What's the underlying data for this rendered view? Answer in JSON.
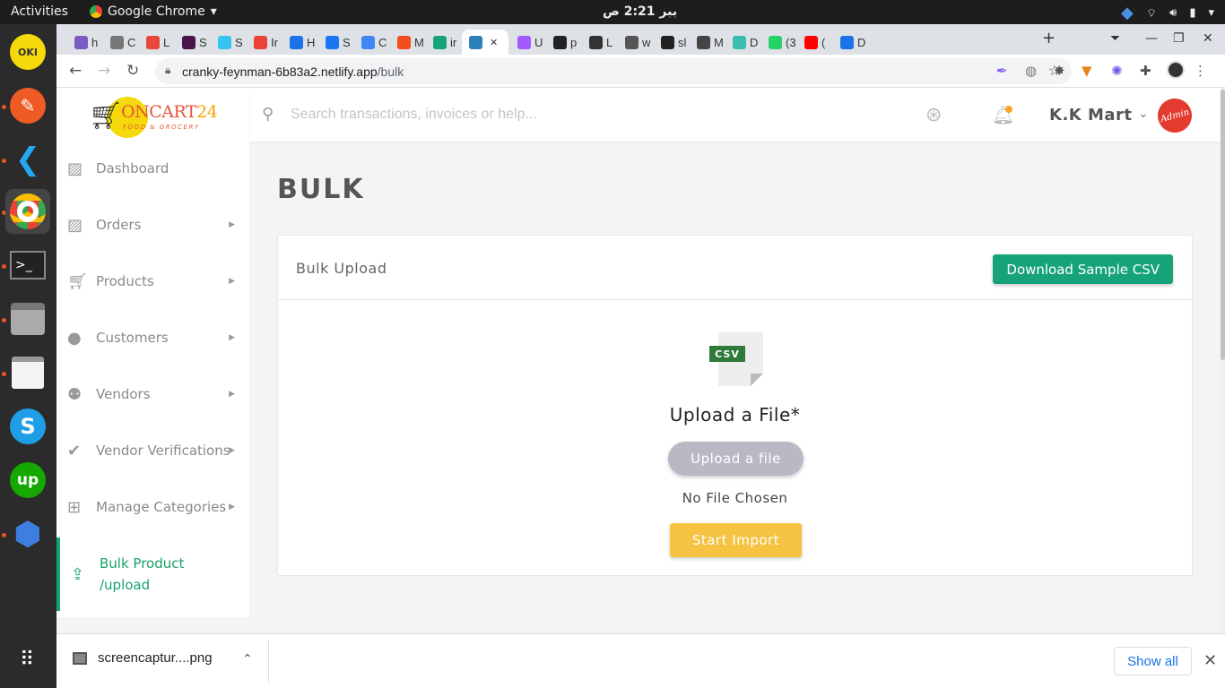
{
  "os": {
    "activities": "Activities",
    "app_name": "Google Chrome",
    "clock": "ببر 2:21 ص"
  },
  "browser": {
    "url_host": "cranky-feynman-6b83a2.netlify.app",
    "url_path": "/bulk",
    "tabs": [
      {
        "label": "h",
        "color": "#7b5cc2"
      },
      {
        "label": "C",
        "color": "#777777"
      },
      {
        "label": "L",
        "color": "#e8453c"
      },
      {
        "label": "S",
        "color": "#4a154b"
      },
      {
        "label": "S",
        "color": "#36c5f0"
      },
      {
        "label": "Ir",
        "color": "#ea4335"
      },
      {
        "label": "H",
        "color": "#1a73e8"
      },
      {
        "label": "S",
        "color": "#1877f2"
      },
      {
        "label": "C",
        "color": "#4285f4"
      },
      {
        "label": "M",
        "color": "#f24e1e"
      },
      {
        "label": "ir",
        "color": "#17a37a"
      },
      {
        "label": "",
        "color": "#2c7fb8"
      },
      {
        "label": "U",
        "color": "#a259ff"
      },
      {
        "label": "p",
        "color": "#222222"
      },
      {
        "label": "L",
        "color": "#333333"
      },
      {
        "label": "w",
        "color": "#555555"
      },
      {
        "label": "sl",
        "color": "#222222"
      },
      {
        "label": "M",
        "color": "#444444"
      },
      {
        "label": "D",
        "color": "#3bbdb0"
      },
      {
        "label": "(3",
        "color": "#25d366"
      },
      {
        "label": "(",
        "color": "#ff0000"
      },
      {
        "label": "D",
        "color": "#1a73e8"
      }
    ]
  },
  "sidebar": {
    "logo": {
      "brand": "ONCART",
      "num": "24",
      "tagline": "FOOD & GROCERY"
    },
    "items": [
      {
        "label": "Dashboard",
        "has_caret": false
      },
      {
        "label": "Orders",
        "has_caret": true
      },
      {
        "label": "Products",
        "has_caret": true
      },
      {
        "label": "Customers",
        "has_caret": true
      },
      {
        "label": "Vendors",
        "has_caret": true
      },
      {
        "label": "Vendor Verifications",
        "has_caret": true
      },
      {
        "label": "Manage Categories",
        "has_caret": true
      },
      {
        "label": "Bulk Product /upload",
        "has_caret": false,
        "active": true
      }
    ]
  },
  "header": {
    "search_placeholder": "Search transactions, invoices or help...",
    "store_name": "K.K Mart",
    "avatar_text": "Admin"
  },
  "main": {
    "page_title": "BULK",
    "card_title": "Bulk Upload",
    "download_button": "Download Sample CSV",
    "file_badge": "CSV",
    "upload_heading": "Upload a File*",
    "upload_button": "Upload a file",
    "no_file_text": "No File Chosen",
    "import_button": "Start Import"
  },
  "downloads": {
    "file_name": "screencaptur....png",
    "show_all": "Show all"
  },
  "colors": {
    "accent_green": "#17a37a",
    "import_yellow": "#f5c242",
    "upload_gray": "#b9b9c6"
  }
}
